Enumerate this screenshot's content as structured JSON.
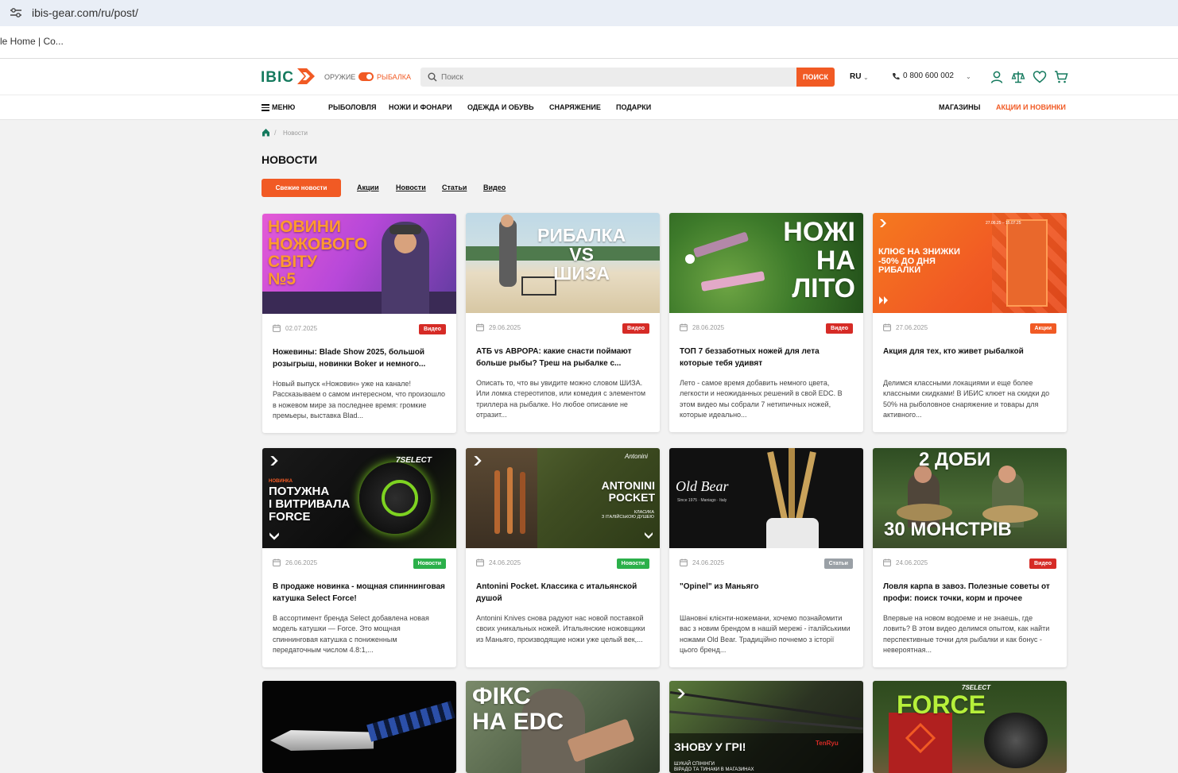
{
  "browser": {
    "url": "ibis-gear.com/ru/post/",
    "bookmark": "le Home | Co..."
  },
  "header": {
    "logo": "IBIC",
    "toggle_left": "ОРУЖИЕ",
    "toggle_right": "РЫБАЛКА",
    "search_placeholder": "Поиск",
    "search_button": "ПОИСК",
    "lang": "RU",
    "phone": "0 800 600 002"
  },
  "nav": {
    "menu": "МЕНЮ",
    "items": [
      "РЫБОЛОВЛЯ",
      "НОЖИ И ФОНАРИ",
      "ОДЕЖДА И ОБУВЬ",
      "СНАРЯЖЕНИЕ",
      "ПОДАРКИ"
    ],
    "stores": "МАГАЗИНЫ",
    "promo": "АКЦИИ И НОВИНКИ"
  },
  "breadcrumb": {
    "current": "Новости"
  },
  "page": {
    "title": "НОВОСТИ",
    "filter_active": "Свежие новости",
    "filters": [
      "Акции",
      "Новости",
      "Статьи",
      "Видео"
    ]
  },
  "colors": {
    "accent": "#f15a24",
    "brand": "#157a5e",
    "badge_video": "#d62b26",
    "badge_news": "#2bb04a",
    "badge_articles": "#9aa0a6",
    "badge_promo": "#f15a24"
  },
  "cards": [
    {
      "thumb_text": "НОВИНИ\nНОЖОВОГО\nСВІТУ\n№5",
      "date": "02.07.2025",
      "badge": "Видео",
      "title": "Ножевины: Blade Show 2025, большой розыгрыш, новинки Boker и немного...",
      "excerpt": " Новый выпуск «Ножовин» уже на канале! Рассказываем о самом интересном, что произошло в ножевом мире за последнее время: громкие премьеры, выставка Blad..."
    },
    {
      "thumb_text": "РИБАЛКА\nVS\nШИЗА",
      "date": "29.06.2025",
      "badge": "Видео",
      "title": "АТБ vs АВРОРА: какие снасти поймают больше рыбы? Треш на рыбалке с...",
      "excerpt": " Описать то, что вы увидите можно словом ШИЗА. Или ломка стереотипов, или комедия с элементом триллера на рыбалке. Но любое описание не отразит..."
    },
    {
      "thumb_text": "НОЖІ\nНА\nЛІТО",
      "date": "28.06.2025",
      "badge": "Видео",
      "title": "ТОП 7 беззаботных ножей для лета которые тебя удивят",
      "excerpt": " Лето - самое время добавить немного цвета, легкости и неожиданных решений в свой EDC. В этом видео мы собрали 7 нетипичных ножей, которые идеально..."
    },
    {
      "thumb_text": "КЛЮЄ НА ЗНИЖКИ\n-50% ДО ДНЯ\nРИБАЛКИ",
      "thumb_date": "27.06.25 – 15.07.25",
      "date": "27.06.2025",
      "badge": "Акции",
      "title": "Акция для тех, кто живет рыбалкой",
      "excerpt": "Делимся классными локациями и еще более классными скидками! В ИБИС клюет на скидки до 50% на рыболовное снаряжение и товары для активного..."
    },
    {
      "thumb_text": "ПОТУЖНА\nІ ВИТРИВАЛА\nFORCE",
      "thumb_sub": "НОВИНКА",
      "thumb_brand": "7SELECT",
      "date": "26.06.2025",
      "badge": "Новости",
      "title": "В продаже новинка - мощная спиннинговая катушка Select Force!",
      "excerpt": "В ассортимент бренда Select добавлена новая модель катушки — Force. Это мощная спиннинговая катушка с пониженным передаточным числом 4.8:1,..."
    },
    {
      "thumb_text": "ANTONINI\nPOCKET",
      "thumb_sub": "КЛАСИКА\nЗ ІТАЛІЙСЬКОЮ ДУШЕЮ",
      "thumb_brand": "Antonini",
      "date": "24.06.2025",
      "badge": "Новости",
      "title": "Antonini Pocket. Классика с итальянской душой",
      "excerpt": "Antonini Knives снова радуют нас новой поставкой своих уникальных ножей. Итальянские ножовщики из Маньяго, производящие ножи уже целый век,..."
    },
    {
      "thumb_text": "Old Bear",
      "thumb_sub": "Since 1975 · Maniago · Italy",
      "date": "24.06.2025",
      "badge": "Статьи",
      "title": "\"Opinel\" из Маньяго",
      "excerpt": "Шановні клієнти-ножемани, хочемо познайомити вас з новим брендом в нашій мережі - італійськими ножами Old Bear. Традиційно почнемо з історії цього бренд..."
    },
    {
      "thumb_text": "2 ДОБИ",
      "thumb_sub": "30 МОНСТРІВ",
      "date": "24.06.2025",
      "badge": "Видео",
      "title": "Ловля карпа в завоз. Полезные советы от профи: поиск точки, корм и прочее",
      "excerpt": " Впервые на новом водоеме и не знаешь, где ловить? В этом видео делимся опытом, как найти перспективные точки для рыбалки и как бонус - невероятная..."
    },
    {
      "thumb_text": ""
    },
    {
      "thumb_text": "ФІКС\nНА EDC"
    },
    {
      "thumb_text": "ЗНОВУ У ГРІ!",
      "thumb_sub": "ШУКАЙ СПІНІНГИ\nВІРАДО ТА ТИНАКИ В МАГАЗИНАХ",
      "thumb_brand": "TenRyu"
    },
    {
      "thumb_text": "FORCE",
      "thumb_brand": "7SELECT"
    }
  ]
}
